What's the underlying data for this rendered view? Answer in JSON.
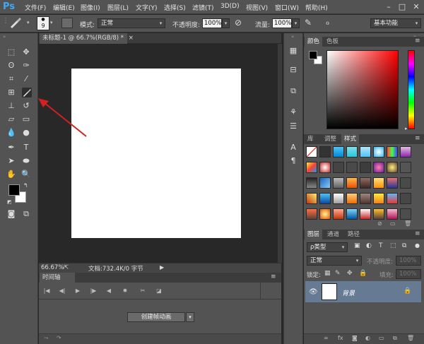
{
  "app": {
    "logo": "Ps",
    "menu": [
      "文件(F)",
      "编辑(E)",
      "图像(I)",
      "图层(L)",
      "文字(Y)",
      "选择(S)",
      "滤镜(T)",
      "3D(D)",
      "视图(V)",
      "窗口(W)",
      "帮助(H)"
    ],
    "window_controls": [
      "–",
      "□",
      "✕"
    ]
  },
  "options": {
    "brush_size": "9",
    "mode_label": "模式:",
    "mode_value": "正常",
    "opacity_label": "不透明度:",
    "opacity_value": "100%",
    "flow_label": "流量:",
    "flow_value": "100%",
    "workspace": "基本功能"
  },
  "document": {
    "tab_title": "未标题-1 @ 66.7%(RGB/8) *",
    "close": "×",
    "zoom": "66.67%",
    "doc_info": "文档:732.4K/0 字节"
  },
  "timeline": {
    "tab": "时间轴",
    "create_button": "创建帧动画"
  },
  "panels": {
    "color_tabs": [
      "颜色",
      "色板"
    ],
    "styles_tabs": [
      "库",
      "调整",
      "样式"
    ],
    "layers_tabs": [
      "图层",
      "通道",
      "路径"
    ],
    "kind_filter": "ρ类型",
    "blend_mode": "正常",
    "opacity_label": "不透明度:",
    "opacity_value": "100%",
    "lock_label": "锁定:",
    "fill_label": "填充:",
    "fill_value": "100%",
    "layer_name": "背景"
  },
  "colors": {
    "foreground": "#000000",
    "background": "#ffffff",
    "annotation_arrow": "#d42020",
    "selected_layer": "#677a94"
  }
}
